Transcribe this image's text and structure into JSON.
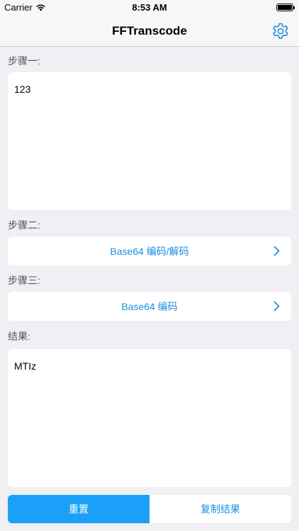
{
  "status_bar": {
    "carrier": "Carrier",
    "time": "8:53 AM",
    "battery_level": 1.0
  },
  "nav": {
    "title": "FFTranscode",
    "settings_icon": "gear-icon"
  },
  "step1": {
    "label": "步骤一:",
    "input_value": "123"
  },
  "step2": {
    "label": "步骤二:",
    "selection": "Base64 编码/解码",
    "chevron_icon": "chevron-right-icon"
  },
  "step3": {
    "label": "步骤三:",
    "selection": "Base64 编码",
    "chevron_icon": "chevron-right-icon"
  },
  "result": {
    "label": "结果:",
    "value": "MTIz"
  },
  "buttons": {
    "reset": "重置",
    "copy": "复制结果"
  },
  "colors": {
    "accent": "#1a8fe3",
    "primary_button": "#1aa0f8",
    "background": "#efeff4"
  }
}
